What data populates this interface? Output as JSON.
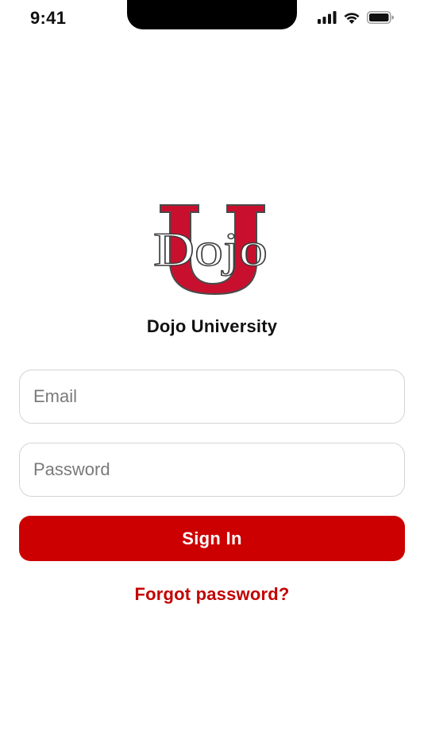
{
  "status_bar": {
    "time": "9:41",
    "icons": [
      "cellular-signal-icon",
      "wifi-icon",
      "battery-icon"
    ]
  },
  "brand": {
    "logo_letter": "U",
    "logo_word": "Dojo",
    "name": "Dojo University"
  },
  "form": {
    "email": {
      "value": "",
      "placeholder": "Email"
    },
    "password": {
      "value": "",
      "placeholder": "Password"
    },
    "sign_in_label": "Sign In",
    "forgot_label": "Forgot password?"
  },
  "colors": {
    "accent": "#cc0000",
    "logo_red": "#c8102e",
    "field_border": "#d4d4d4",
    "background": "#ffffff"
  }
}
